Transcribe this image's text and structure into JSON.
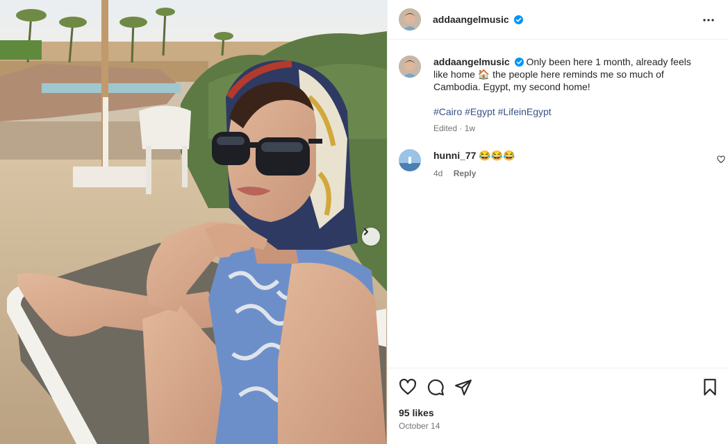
{
  "post": {
    "username": "addaangelmusic",
    "more_icon": "more-horizontal-icon",
    "caption_text": "Only been here 1 month, already feels like home 🏠 the people here reminds me so much of Cambodia. Egypt, my second home!",
    "hashtags": [
      "#Cairo",
      "#Egypt",
      "#LifeinEgypt"
    ],
    "edited_label": "Edited · 1w",
    "likes": "95 likes",
    "date": "October 14"
  },
  "comments": [
    {
      "username": "hunni_77",
      "emoji_text": "😂😂😂",
      "time": "4d",
      "reply_label": "Reply"
    }
  ],
  "icons": {
    "like": "heart-icon",
    "comment": "comment-icon",
    "share": "share-icon",
    "save": "bookmark-icon",
    "next": "chevron-right-icon",
    "verified": "verified-badge-icon"
  },
  "colors": {
    "verified_blue": "#0095f6",
    "hashtag": "#385185",
    "muted": "#737373"
  }
}
